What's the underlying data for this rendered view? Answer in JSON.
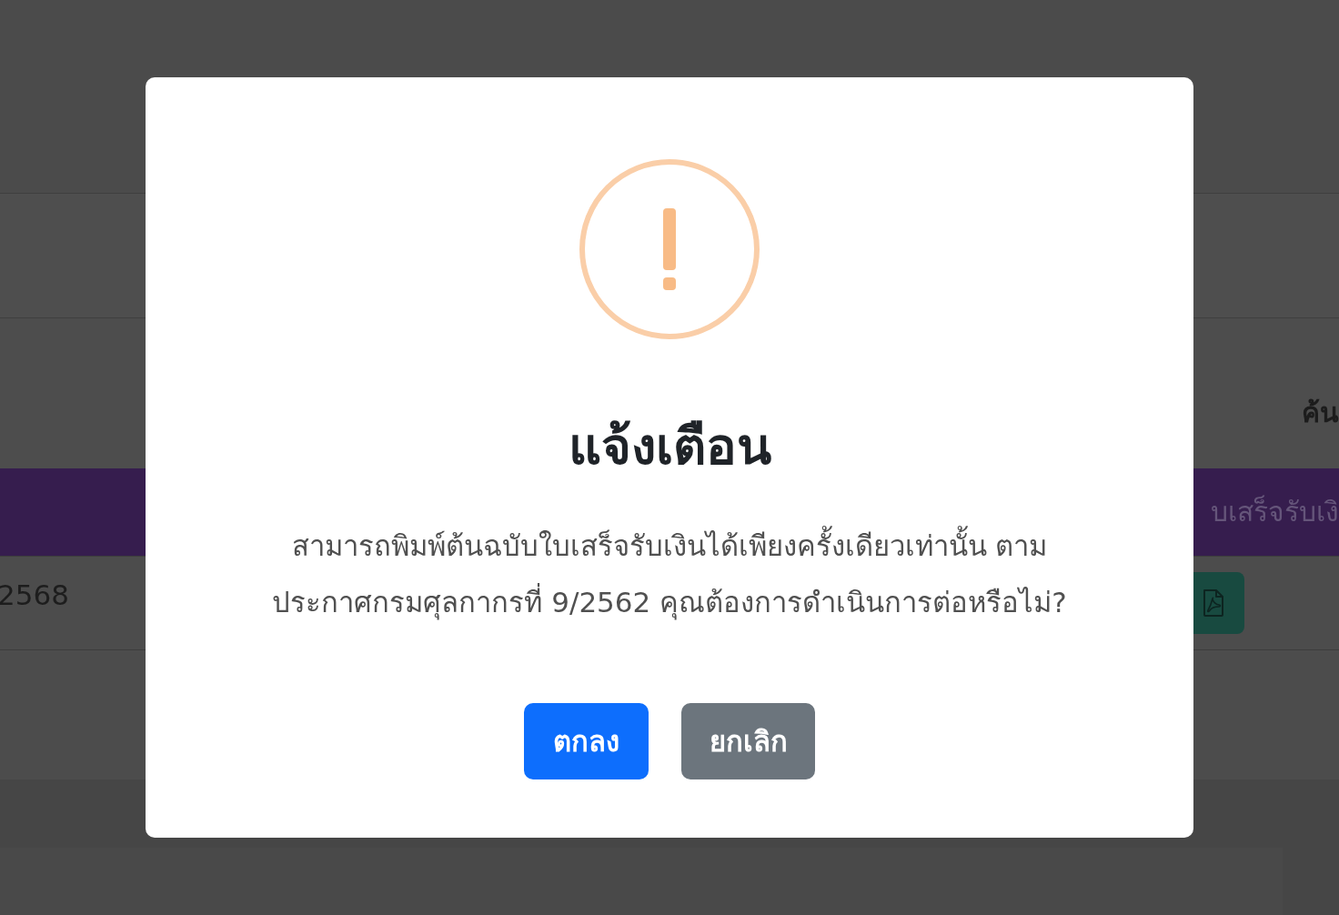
{
  "background": {
    "search_label": "ค้น",
    "table_header": "บเสร็จรับเงิ",
    "row_cell": "2568",
    "row_action": {
      "kind": "pdf"
    }
  },
  "dialog": {
    "kind": "warning",
    "title": "แจ้งเตือน",
    "message_lines": [
      "สามารถพิมพ์ต้นฉบับใบเสร็จรับเงินได้เพียงครั้งเดียวเท่านั้น ตาม",
      "ประกาศกรมศุลกากรที่ 9/2562 คุณต้องการดำเนินการต่อหรือไม่?"
    ],
    "buttons": [
      {
        "label": "ตกลง",
        "kind": "confirm"
      },
      {
        "label": "ยกเลิก",
        "kind": "cancel"
      }
    ]
  }
}
